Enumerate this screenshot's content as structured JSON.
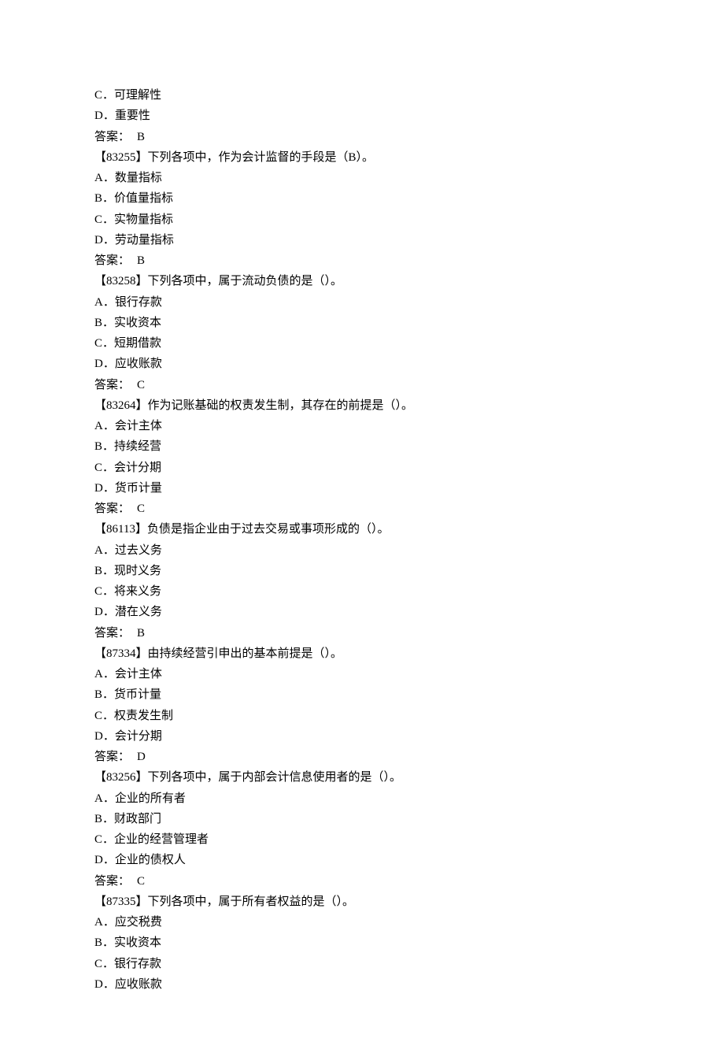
{
  "prefix_options": [
    {
      "letter": "C",
      "text": "可理解性"
    },
    {
      "letter": "D",
      "text": "重要性"
    }
  ],
  "prefix_answer": "B",
  "questions": [
    {
      "id": "83255",
      "stem": "下列各项中，作为会计监督的手段是（B）。",
      "options": [
        {
          "letter": "A",
          "text": "数量指标"
        },
        {
          "letter": "B",
          "text": "价值量指标"
        },
        {
          "letter": "C",
          "text": "实物量指标"
        },
        {
          "letter": "D",
          "text": "劳动量指标"
        }
      ],
      "answer": "B"
    },
    {
      "id": "83258",
      "stem": "下列各项中，属于流动负债的是（）。",
      "options": [
        {
          "letter": "A",
          "text": "银行存款"
        },
        {
          "letter": "B",
          "text": "实收资本"
        },
        {
          "letter": "C",
          "text": "短期借款"
        },
        {
          "letter": "D",
          "text": "应收账款"
        }
      ],
      "answer": "C"
    },
    {
      "id": "83264",
      "stem": "作为记账基础的权责发生制，其存在的前提是（）。",
      "options": [
        {
          "letter": "A",
          "text": "会计主体"
        },
        {
          "letter": "B",
          "text": "持续经营"
        },
        {
          "letter": "C",
          "text": "会计分期"
        },
        {
          "letter": "D",
          "text": "货币计量"
        }
      ],
      "answer": "C"
    },
    {
      "id": "86113",
      "stem": "负债是指企业由于过去交易或事项形成的（）。",
      "options": [
        {
          "letter": "A",
          "text": "过去义务"
        },
        {
          "letter": "B",
          "text": "现时义务"
        },
        {
          "letter": "C",
          "text": "将来义务"
        },
        {
          "letter": "D",
          "text": "潜在义务"
        }
      ],
      "answer": "B"
    },
    {
      "id": "87334",
      "stem": "由持续经营引申出的基本前提是（）。",
      "options": [
        {
          "letter": "A",
          "text": "会计主体"
        },
        {
          "letter": "B",
          "text": "货币计量"
        },
        {
          "letter": "C",
          "text": "权责发生制"
        },
        {
          "letter": "D",
          "text": "会计分期"
        }
      ],
      "answer": "D"
    },
    {
      "id": "83256",
      "stem": "下列各项中，属于内部会计信息使用者的是（）。",
      "options": [
        {
          "letter": "A",
          "text": "企业的所有者"
        },
        {
          "letter": "B",
          "text": "财政部门"
        },
        {
          "letter": "C",
          "text": "企业的经营管理者"
        },
        {
          "letter": "D",
          "text": "企业的债权人"
        }
      ],
      "answer": "C"
    },
    {
      "id": "87335",
      "stem": "下列各项中，属于所有者权益的是（）。",
      "options": [
        {
          "letter": "A",
          "text": "应交税费"
        },
        {
          "letter": "B",
          "text": "实收资本"
        },
        {
          "letter": "C",
          "text": "银行存款"
        },
        {
          "letter": "D",
          "text": "应收账款"
        }
      ],
      "answer": null
    }
  ],
  "labels": {
    "answer_prefix": "答案：",
    "option_sep": "．"
  }
}
